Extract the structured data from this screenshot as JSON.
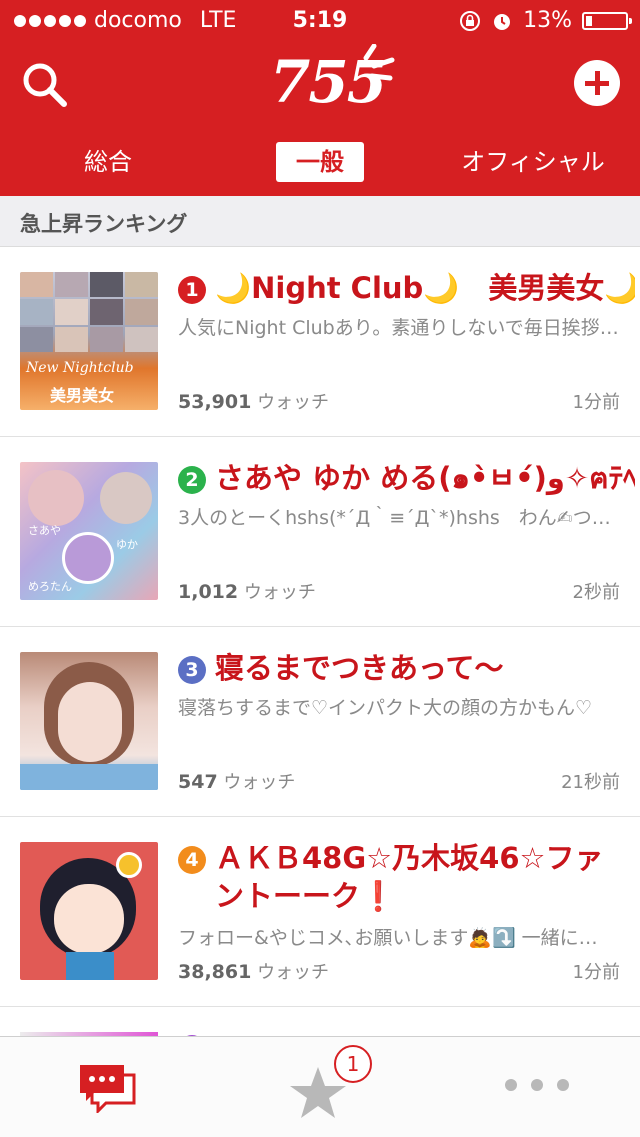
{
  "status": {
    "carrier": "docomo",
    "network": "LTE",
    "time": "5:19",
    "battery": "13%"
  },
  "header": {
    "logo": "755"
  },
  "tabs": [
    {
      "label": "総合",
      "active": false
    },
    {
      "label": "一般",
      "active": true
    },
    {
      "label": "オフィシャル",
      "active": false
    }
  ],
  "section": {
    "title": "急上昇ランキング"
  },
  "items": [
    {
      "rank": "1",
      "title": "🌙Night Club🌙　美男美女🌙",
      "desc": "人気にNight Clubあり。素通りしないで毎日挨拶してね",
      "watch_count": "53,901",
      "watch_label": "ウォッチ",
      "time": "1分前",
      "thumb_text": "New Nightclub",
      "thumb_sub": "美男美女"
    },
    {
      "rank": "2",
      "title": "さあや ゆか める(๑•̀ㅂ•́)و✧ฅﾃﾍ-",
      "desc": "3人のとーくhshs(*´Д｀≡´Д`*)hshs　わん✍つぅ…",
      "watch_count": "1,012",
      "watch_label": "ウォッチ",
      "time": "2秒前",
      "thumb_labels": [
        "さあや",
        "ゆか",
        "めろたん"
      ]
    },
    {
      "rank": "3",
      "title": "寝るまでつきあって〜",
      "desc": "寝落ちするまで♡インパクト大の顔の方かもん♡",
      "watch_count": "547",
      "watch_label": "ウォッチ",
      "time": "21秒前"
    },
    {
      "rank": "4",
      "title": "ＡＫＢ48G☆乃木坂46☆ファントーーク❗",
      "desc": "フォロー&やじコメ､お願いします🙇⤵️ 一緒に…",
      "watch_count": "38,861",
      "watch_label": "ウォッチ",
      "time": "1分前"
    }
  ],
  "rank_colors": [
    "#d61f22",
    "#2bb24c",
    "#5b6fc4",
    "#f28c1c"
  ],
  "tabbar": {
    "star_badge": "1"
  },
  "icons": [
    "search-icon",
    "add-icon",
    "chat-icon",
    "star-icon",
    "more-icon",
    "alarm-icon",
    "lock-rotation-icon",
    "battery-icon"
  ]
}
